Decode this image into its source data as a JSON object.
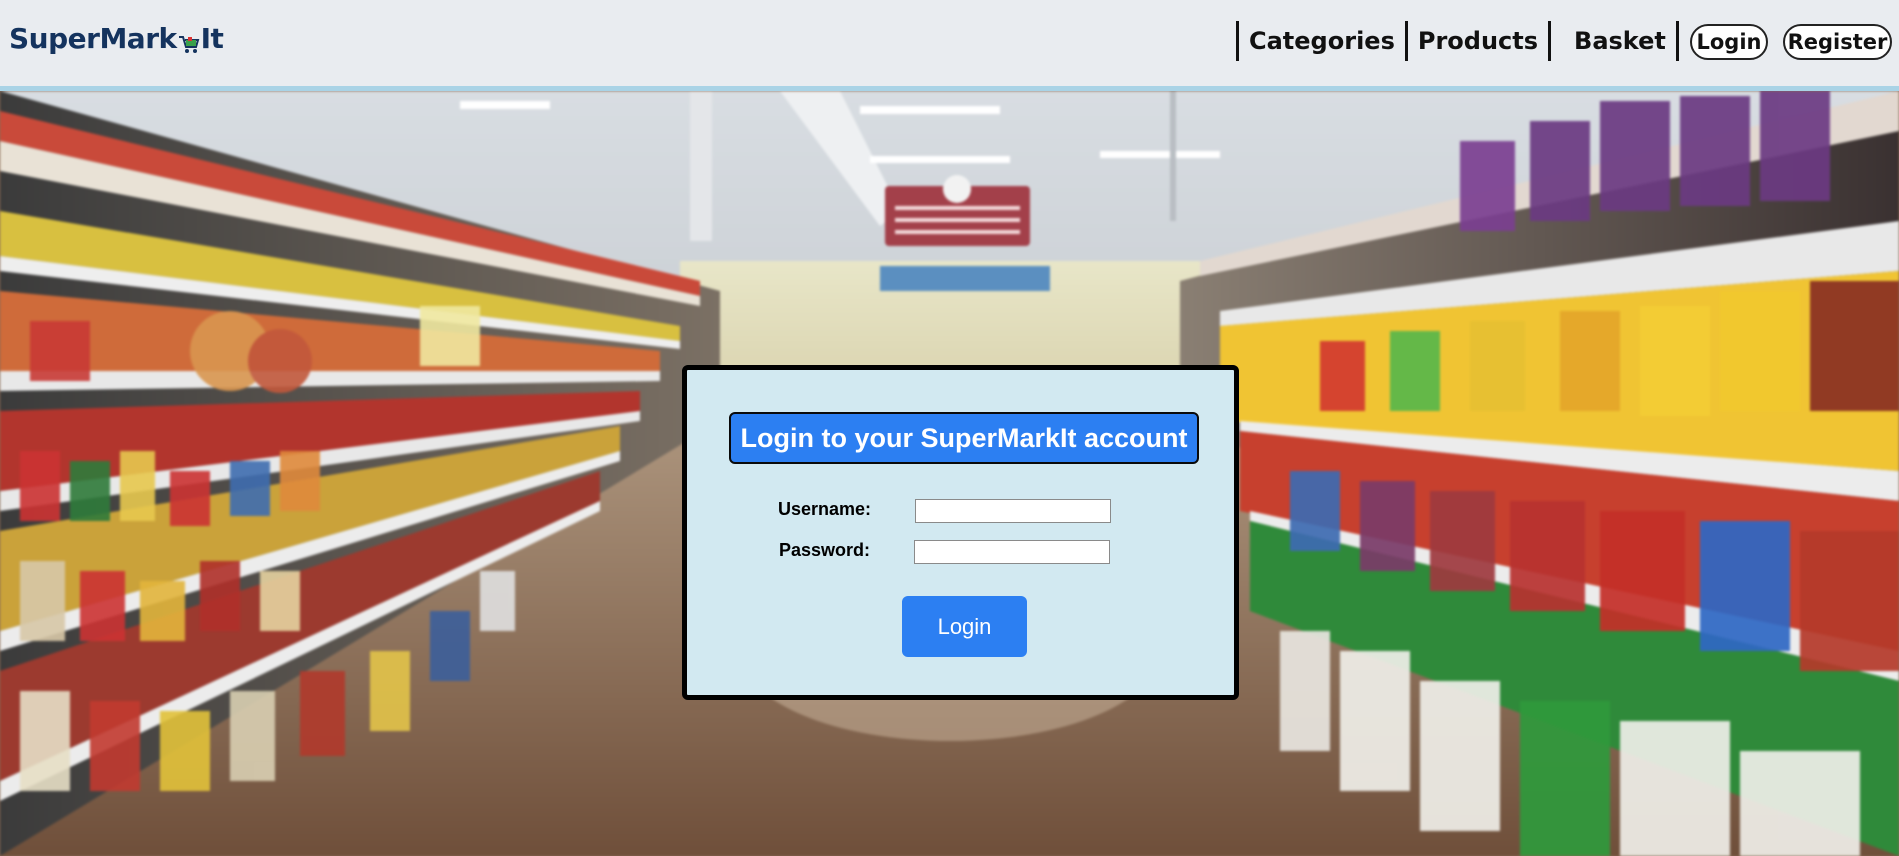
{
  "header": {
    "logo_prefix": "SuperMark",
    "logo_suffix": "It",
    "nav": [
      "Categories",
      "Products",
      "Basket"
    ],
    "login_label": "Login",
    "register_label": "Register"
  },
  "login_card": {
    "title": "Login to your SuperMarkIt account",
    "username_label": "Username:",
    "username_value": "",
    "password_label": "Password:",
    "password_value": "",
    "submit_label": "Login"
  },
  "colors": {
    "header_bg": "#e9ecf0",
    "header_border": "#a9d3e6",
    "logo_text": "#14335e",
    "card_bg": "#d2e9f1",
    "accent_blue": "#2c7ff2"
  },
  "background_image": "supermarket-aisle-photo"
}
